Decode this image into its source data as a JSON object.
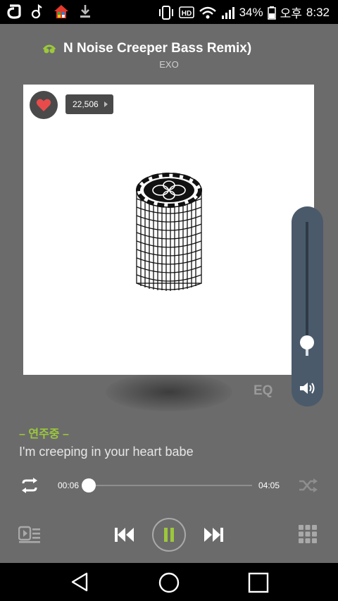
{
  "status": {
    "battery": "34%",
    "ampm": "오후",
    "time": "8:32",
    "icons": [
      "olleh-icon",
      "music-note-icon",
      "home-app-icon",
      "download-icon",
      "vibrate-icon",
      "hd-icon",
      "wifi-icon",
      "signal-icon",
      "battery-icon"
    ]
  },
  "track": {
    "title": "N Noise Creeper Bass Remix)",
    "artist": "EXO",
    "like_count": "22,506"
  },
  "eq_label": "EQ",
  "volume": {
    "level": 0.1
  },
  "lyrics": {
    "status": "– 연주중 –",
    "line": "I'm creeping in your heart babe"
  },
  "playback": {
    "current_time": "00:06",
    "total_time": "04:05",
    "progress": 0.025,
    "state": "playing"
  },
  "colors": {
    "accent_green": "#9cc83b",
    "heart_red": "#e94b4b",
    "background": "#6b6b6b",
    "volume_panel": "#4a5a6b"
  }
}
